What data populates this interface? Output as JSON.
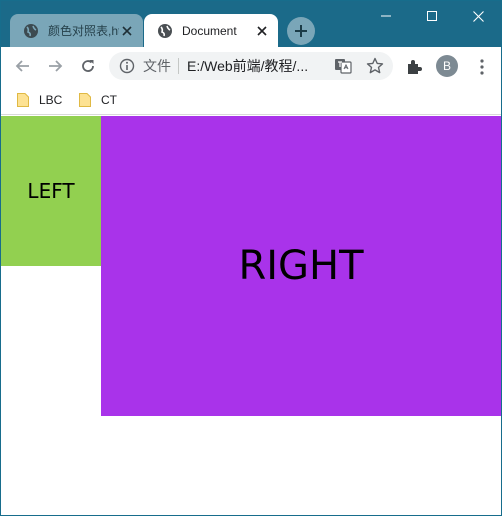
{
  "tabs": [
    {
      "title": "颜色对照表,html",
      "active": false
    },
    {
      "title": "Document",
      "active": true
    }
  ],
  "toolbar": {
    "scheme_label": "文件",
    "url": "E:/Web前端/教程/...",
    "avatar_letter": "B"
  },
  "bookmarks": [
    {
      "label": "LBC"
    },
    {
      "label": "CT"
    }
  ],
  "page": {
    "left_text": "LEFT",
    "right_text": "RIGHT"
  },
  "colors": {
    "titlebar": "#1b6a89",
    "left_box": "#92d050",
    "right_box": "#a933ea"
  }
}
